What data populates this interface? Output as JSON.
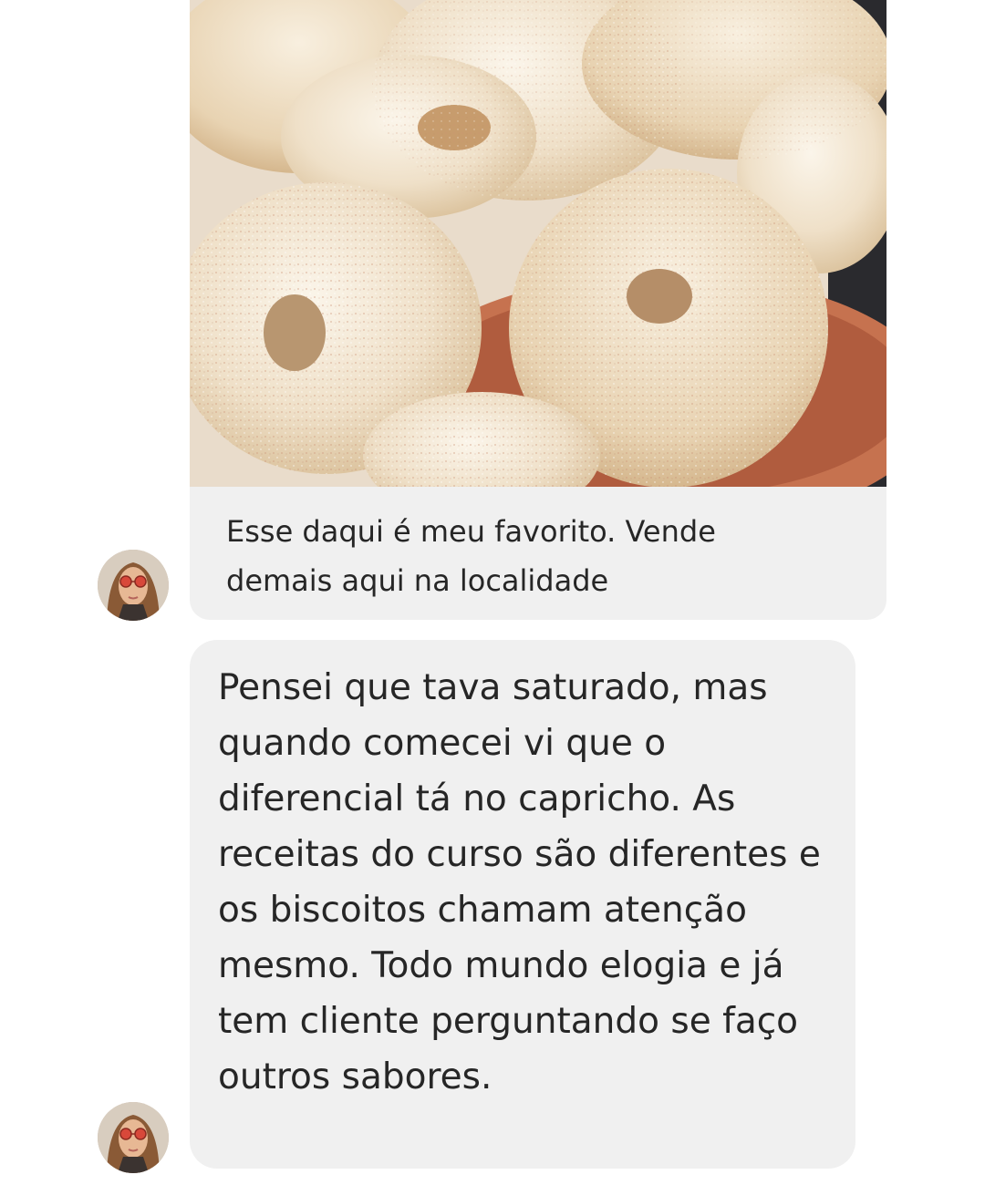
{
  "chat": {
    "messages": [
      {
        "type": "image",
        "image_alt": "Biscoitos em formato de rosca polvilhados com açúcar em uma tigela",
        "caption": "Esse daqui é meu favorito. Vende demais aqui na localidade",
        "avatar_icon": "user-avatar-icon"
      },
      {
        "type": "text",
        "text": "Pensei que tava saturado, mas quando comecei vi que o diferencial tá no capricho. As receitas do curso são diferentes e os biscoitos chamam atenção mesmo. Todo mundo elogia e já tem cliente perguntando se faço outros sabores.",
        "avatar_icon": "user-avatar-icon"
      }
    ]
  },
  "colors": {
    "bubble": "#f0f0f0",
    "text": "#262626",
    "background": "#ffffff"
  }
}
